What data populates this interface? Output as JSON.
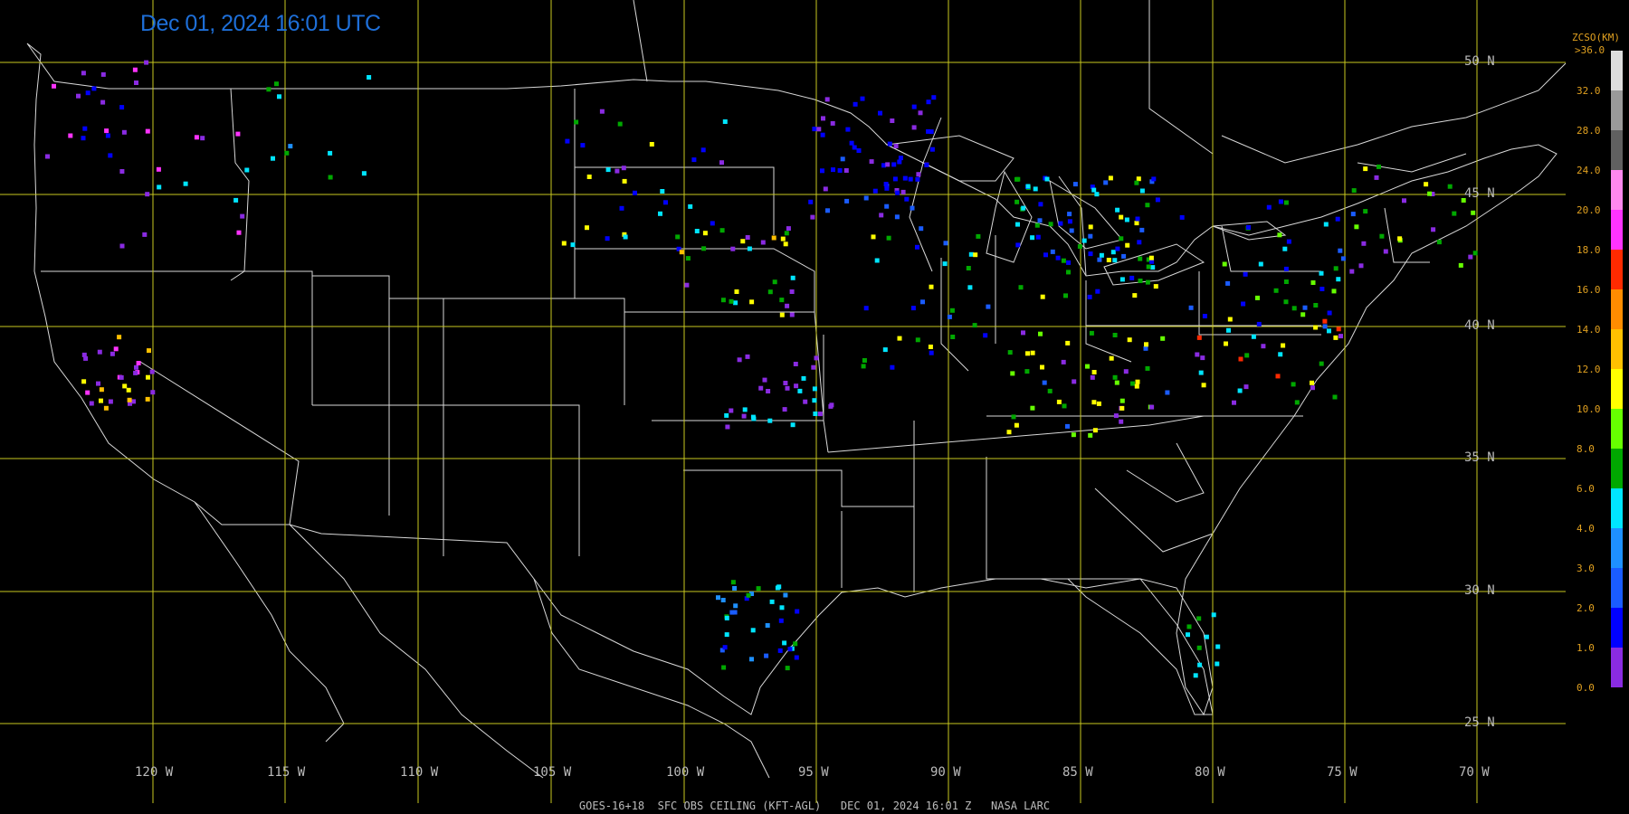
{
  "timestamp": "Dec 01, 2024 16:01 UTC",
  "footer": "GOES-16+18  SFC OBS CEILING (KFT-AGL)   DEC 01, 2024 16:01 Z   NASA LARC",
  "lat_labels": [
    "50 N",
    "45 N",
    "40 N",
    "35 N",
    "30 N",
    "25 N"
  ],
  "lon_labels": [
    "120 W",
    "115 W",
    "110 W",
    "105 W",
    "100 W",
    "95 W",
    "90 W",
    "85 W",
    "80 W",
    "75 W",
    "70 W"
  ],
  "legend": {
    "title": "ZCSO(KM)",
    "top_label": ">36.0",
    "ticks": [
      "32.0",
      "28.0",
      "24.0",
      "20.0",
      "18.0",
      "16.0",
      "14.0",
      "12.0",
      "10.0",
      "8.0",
      "6.0",
      "4.0",
      "3.0",
      "2.0",
      "1.0",
      "0.0"
    ],
    "colors": [
      "#8a2be2",
      "#0000ff",
      "#1a5cff",
      "#1e90ff",
      "#00e5ff",
      "#00a800",
      "#66ff00",
      "#ffff00",
      "#ffc000",
      "#ff8c00",
      "#ff2a00",
      "#ff33ff",
      "#ff88ee",
      "#606060",
      "#9a9a9a",
      "#dddddd"
    ]
  },
  "colors": {
    "grid": "#c8c820",
    "boundary": "#d8d8d8",
    "timestamp": "#1e6fd8",
    "label": "#bbbbbb"
  }
}
